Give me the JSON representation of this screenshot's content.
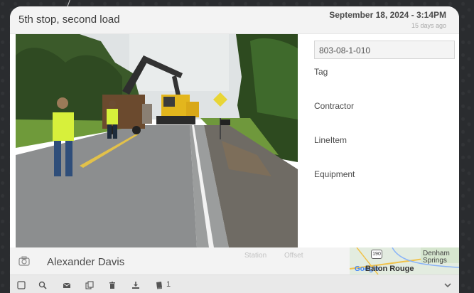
{
  "header": {
    "title": "5th stop, second load",
    "date": "September 18, 2024 - 3:14PM",
    "ago": "15 days ago"
  },
  "details": {
    "id_value": "803-08-1-010",
    "labels": [
      "Tag",
      "Contractor",
      "LineItem",
      "Equipment"
    ]
  },
  "footer": {
    "person": "Alexander Davis",
    "station_label": "Station",
    "offset_label": "Offset",
    "map": {
      "shield": "190",
      "city_denham_line1": "Denham",
      "city_denham_line2": "Springs",
      "city_baton": "Baton Rouge",
      "google": "Google"
    }
  },
  "toolbar": {
    "icons": [
      "checkbox-icon",
      "zoom-icon",
      "mail-icon",
      "copy-icon",
      "trash-icon",
      "download-icon",
      "book-icon"
    ],
    "count": "1",
    "expand": "chevron-down-icon"
  },
  "colors": {
    "header_bg": "#f3f3f3",
    "card_bg": "#ffffff",
    "page_bg": "#2b2d30",
    "vest_yellow": "#d7f03b",
    "excavator": "#e3b61d"
  }
}
